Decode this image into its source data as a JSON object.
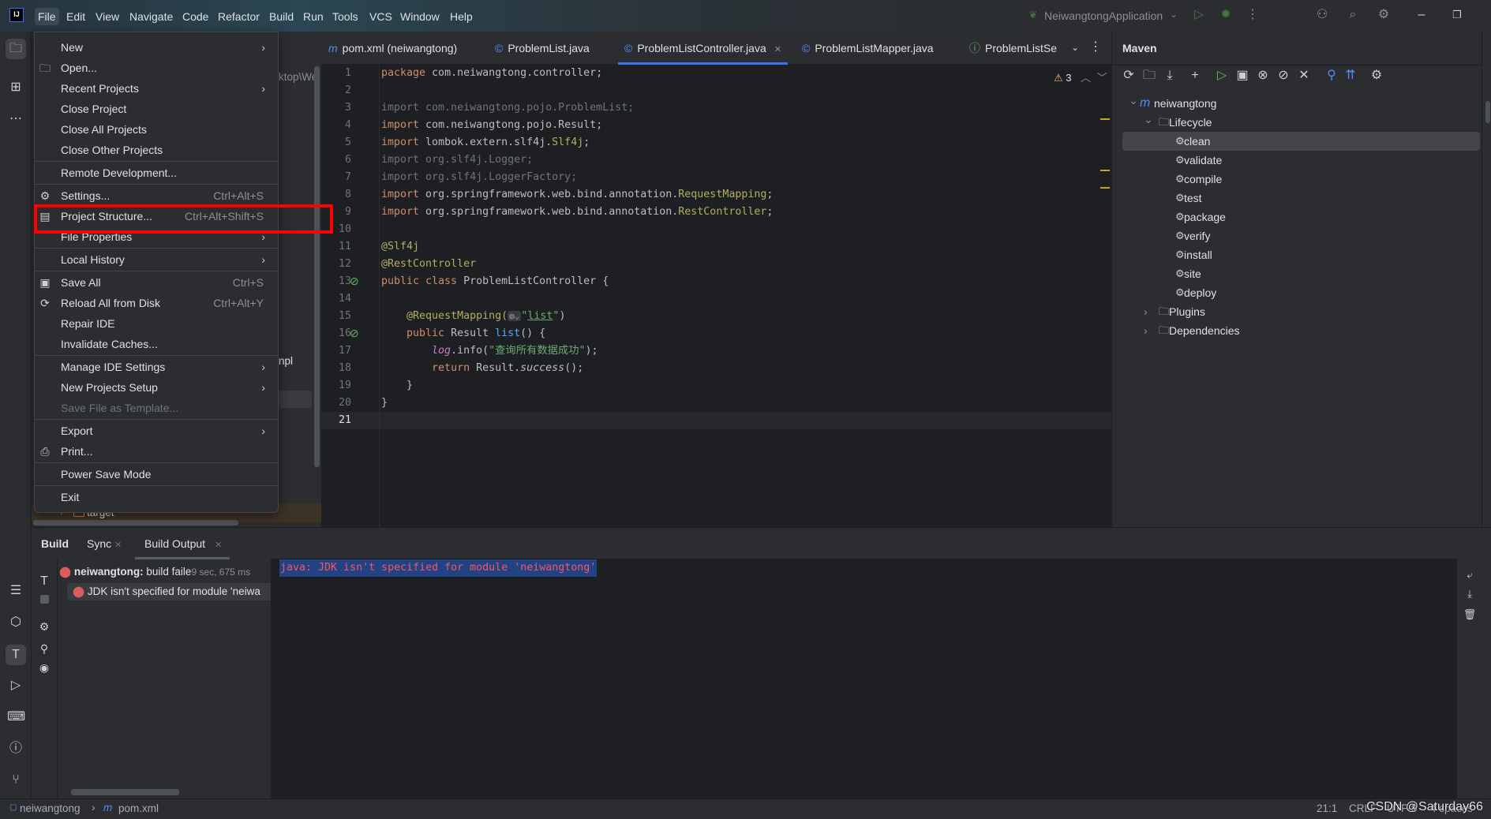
{
  "titlebar": {
    "menus": [
      "File",
      "Edit",
      "View",
      "Navigate",
      "Code",
      "Refactor",
      "Build",
      "Run",
      "Tools",
      "VCS",
      "Window",
      "Help"
    ],
    "active_menu": "File",
    "logo_text": "IJ",
    "run_config": "NeiwangtongApplication"
  },
  "editor": {
    "tabs": [
      {
        "label": "pom.xml (neiwangtong)",
        "icon": "m"
      },
      {
        "label": "ProblemList.java",
        "icon": "©"
      },
      {
        "label": "ProblemListController.java",
        "icon": "©",
        "active": true
      },
      {
        "label": "ProblemListMapper.java",
        "icon": "©"
      },
      {
        "label": "ProblemListSe",
        "icon": "ⓘ"
      }
    ],
    "warning_count": "3",
    "current_line": 21,
    "lines": [
      [
        [
          "kw",
          "package"
        ],
        [
          "tx",
          " com.neiwangtong.controller;"
        ]
      ],
      [],
      [
        [
          "un",
          "import com.neiwangtong.pojo.ProblemList;"
        ]
      ],
      [
        [
          "kw",
          "import"
        ],
        [
          "tx",
          " com.neiwangtong.pojo.Result;"
        ]
      ],
      [
        [
          "kw",
          "import"
        ],
        [
          "tx",
          " lombok.extern.slf4j."
        ],
        [
          "an",
          "Slf4j"
        ],
        [
          "tx",
          ";"
        ]
      ],
      [
        [
          "un",
          "import org.slf4j.Logger;"
        ]
      ],
      [
        [
          "un",
          "import org.slf4j.LoggerFactory;"
        ]
      ],
      [
        [
          "kw",
          "import"
        ],
        [
          "tx",
          " org.springframework.web.bind.annotation."
        ],
        [
          "an",
          "RequestMapping"
        ],
        [
          "tx",
          ";"
        ]
      ],
      [
        [
          "kw",
          "import"
        ],
        [
          "tx",
          " org.springframework.web.bind.annotation."
        ],
        [
          "an",
          "RestController"
        ],
        [
          "tx",
          ";"
        ]
      ],
      [],
      [
        [
          "an",
          "@Slf4j"
        ]
      ],
      [
        [
          "an",
          "@RestController"
        ]
      ],
      [
        [
          "kw",
          "public class "
        ],
        [
          "tx",
          "ProblemListController {"
        ]
      ],
      [],
      [
        [
          "tx",
          "    "
        ],
        [
          "an",
          "@RequestMapping("
        ],
        [
          "inlay",
          "◍⌄"
        ],
        [
          "st",
          "\""
        ],
        [
          "stu",
          "list"
        ],
        [
          "st",
          "\""
        ],
        [
          "tx",
          ")"
        ]
      ],
      [
        [
          "tx",
          "    "
        ],
        [
          "kw",
          "public "
        ],
        [
          "tx",
          "Result "
        ],
        [
          "mt",
          "list"
        ],
        [
          "tx",
          "() {"
        ]
      ],
      [
        [
          "tx",
          "        "
        ],
        [
          "fd",
          "log"
        ],
        [
          "tx",
          ".info("
        ],
        [
          "st",
          "\"查询所有数据成功\""
        ],
        [
          "tx",
          ");"
        ]
      ],
      [
        [
          "tx",
          "        "
        ],
        [
          "kw",
          "return "
        ],
        [
          "tx",
          "Result."
        ],
        [
          "it",
          "success"
        ],
        [
          "tx",
          "();"
        ]
      ],
      [
        [
          "tx",
          "    }"
        ]
      ],
      [
        [
          "tx",
          "}"
        ]
      ],
      []
    ]
  },
  "project_panel": {
    "path_fragment": "ktop\\We",
    "impl_fragment": "npl",
    "target_folder": "target"
  },
  "file_menu": [
    {
      "label": "New",
      "submenu": true
    },
    {
      "label": "Open...",
      "icon": "folder-icon"
    },
    {
      "label": "Recent Projects",
      "submenu": true
    },
    {
      "label": "Close Project"
    },
    {
      "label": "Close All Projects"
    },
    {
      "label": "Close Other Projects"
    },
    {
      "separator": true
    },
    {
      "label": "Remote Development..."
    },
    {
      "separator": true
    },
    {
      "label": "Settings...",
      "shortcut": "Ctrl+Alt+S",
      "icon": "gear-icon"
    },
    {
      "label": "Project Structure...",
      "shortcut": "Ctrl+Alt+Shift+S",
      "icon": "project-structure-icon",
      "highlighted": true
    },
    {
      "label": "File Properties",
      "submenu": true
    },
    {
      "separator": true
    },
    {
      "label": "Local History",
      "submenu": true
    },
    {
      "separator": true
    },
    {
      "label": "Save All",
      "shortcut": "Ctrl+S",
      "icon": "save-icon"
    },
    {
      "label": "Reload All from Disk",
      "shortcut": "Ctrl+Alt+Y",
      "icon": "reload-icon"
    },
    {
      "label": "Repair IDE"
    },
    {
      "label": "Invalidate Caches..."
    },
    {
      "separator": true
    },
    {
      "label": "Manage IDE Settings",
      "submenu": true
    },
    {
      "label": "New Projects Setup",
      "submenu": true
    },
    {
      "label": "Save File as Template...",
      "disabled": true
    },
    {
      "separator": true
    },
    {
      "label": "Export",
      "submenu": true
    },
    {
      "label": "Print...",
      "icon": "print-icon"
    },
    {
      "separator": true
    },
    {
      "label": "Power Save Mode"
    },
    {
      "separator": true
    },
    {
      "label": "Exit"
    }
  ],
  "maven": {
    "title": "Maven",
    "tree": [
      {
        "label": "neiwangtong",
        "level": 0,
        "icon": "maven-icon",
        "expanded": true
      },
      {
        "label": "Lifecycle",
        "level": 1,
        "icon": "folder-gear-icon",
        "expanded": true
      },
      {
        "label": "clean",
        "level": 2,
        "icon": "gear-icon",
        "selected": true
      },
      {
        "label": "validate",
        "level": 2,
        "icon": "gear-icon"
      },
      {
        "label": "compile",
        "level": 2,
        "icon": "gear-icon"
      },
      {
        "label": "test",
        "level": 2,
        "icon": "gear-icon"
      },
      {
        "label": "package",
        "level": 2,
        "icon": "gear-icon"
      },
      {
        "label": "verify",
        "level": 2,
        "icon": "gear-icon"
      },
      {
        "label": "install",
        "level": 2,
        "icon": "gear-icon"
      },
      {
        "label": "site",
        "level": 2,
        "icon": "gear-icon"
      },
      {
        "label": "deploy",
        "level": 2,
        "icon": "gear-icon"
      },
      {
        "label": "Plugins",
        "level": 1,
        "icon": "folder-gear-icon",
        "expanded": false
      },
      {
        "label": "Dependencies",
        "level": 1,
        "icon": "folder-chart-icon",
        "expanded": false
      }
    ]
  },
  "build": {
    "tabs": [
      "Build",
      "Sync",
      "Build Output"
    ],
    "active_tab": "Build Output",
    "tree_root": {
      "project": "neiwangtong:",
      "status": "build faile",
      "duration": "9 sec, 675 ms"
    },
    "tree_child": "JDK isn't specified for module 'neiwa",
    "output": "java: JDK isn't specified for module 'neiwangtong'"
  },
  "status_bar": {
    "breadcrumb": [
      "neiwangtong",
      "pom.xml"
    ],
    "position": "21:1",
    "line_sep": "CRLF",
    "encoding": "UTF-8",
    "indent": "4 spaces",
    "watermark": "CSDN @Saturday66"
  },
  "colors": {
    "accent": "#3574f0",
    "highlight_box": "#ff0000",
    "error": "#db5c5c",
    "output_error": "#f75464",
    "selection": "#214283"
  }
}
